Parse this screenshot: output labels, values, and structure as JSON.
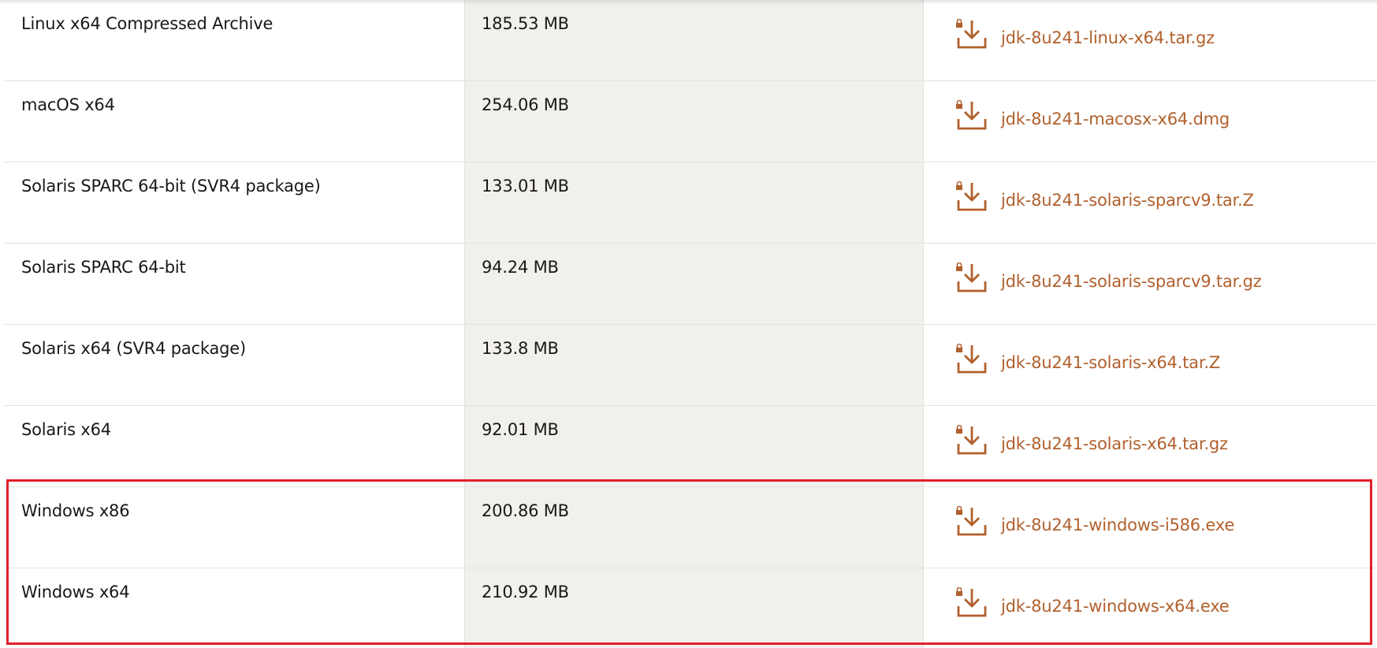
{
  "downloads": {
    "rows": [
      {
        "platform": "Linux x64 Compressed Archive",
        "size": "185.53 MB",
        "file": "jdk-8u241-linux-x64.tar.gz"
      },
      {
        "platform": "macOS x64",
        "size": "254.06 MB",
        "file": "jdk-8u241-macosx-x64.dmg"
      },
      {
        "platform": "Solaris SPARC 64-bit (SVR4 package)",
        "size": "133.01 MB",
        "file": "jdk-8u241-solaris-sparcv9.tar.Z"
      },
      {
        "platform": "Solaris SPARC 64-bit",
        "size": "94.24 MB",
        "file": "jdk-8u241-solaris-sparcv9.tar.gz"
      },
      {
        "platform": "Solaris x64 (SVR4 package)",
        "size": "133.8 MB",
        "file": "jdk-8u241-solaris-x64.tar.Z"
      },
      {
        "platform": "Solaris x64",
        "size": "92.01 MB",
        "file": "jdk-8u241-solaris-x64.tar.gz"
      },
      {
        "platform": "Windows x86",
        "size": "200.86 MB",
        "file": "jdk-8u241-windows-i586.exe"
      },
      {
        "platform": "Windows x64",
        "size": "210.92 MB",
        "file": "jdk-8u241-windows-x64.exe"
      }
    ]
  },
  "icons": {
    "download": "download-locked-icon"
  },
  "colors": {
    "link": "#b1602d",
    "size_column_bg": "#f2f0ec",
    "highlight": "#e0202a"
  }
}
